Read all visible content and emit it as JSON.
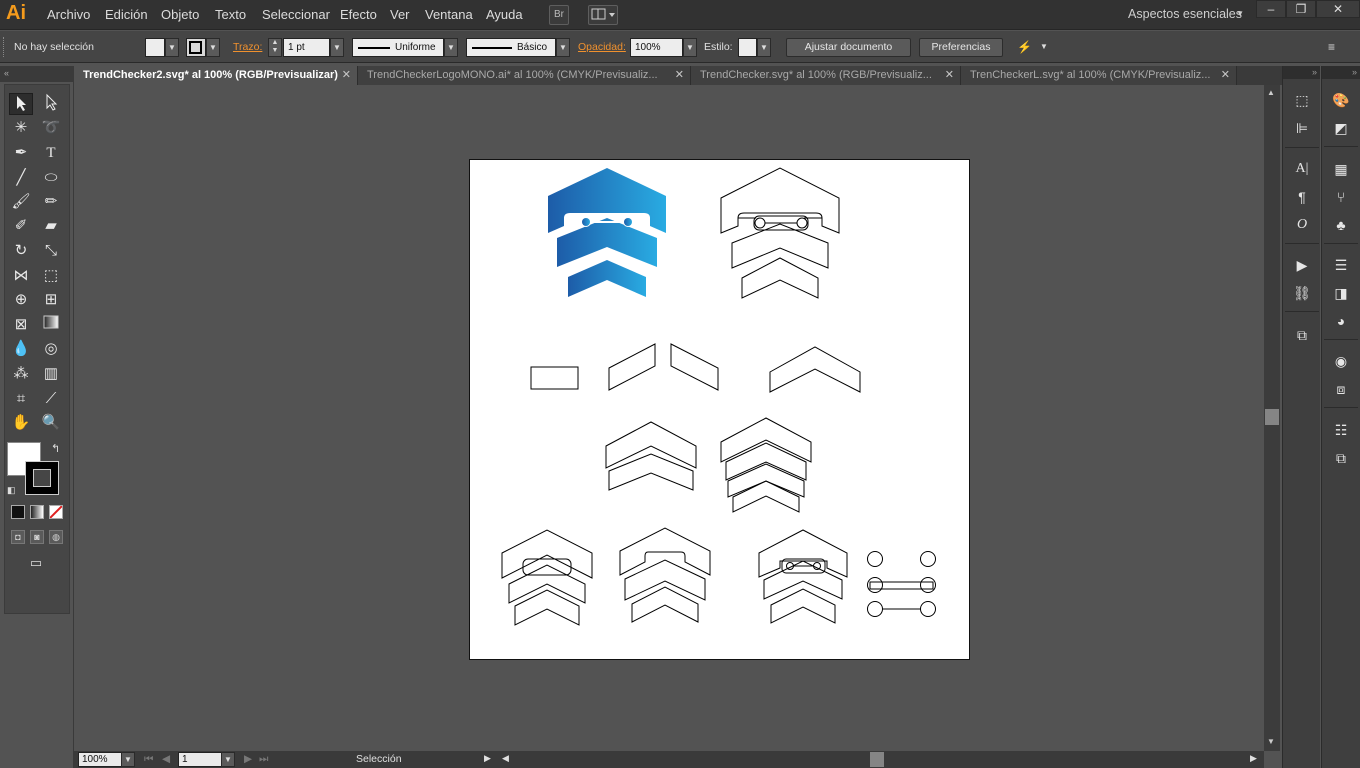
{
  "app": {
    "logo": "Ai"
  },
  "menu": {
    "items": [
      "Archivo",
      "Edición",
      "Objeto",
      "Texto",
      "Seleccionar",
      "Efecto",
      "Ver",
      "Ventana",
      "Ayuda"
    ],
    "bridge": "Br",
    "workspace": "Aspectos esenciales"
  },
  "control": {
    "selection": "No hay selección",
    "stroke_label": "Trazo:",
    "stroke_weight": "1 pt",
    "profile": "Uniforme",
    "brush": "Básico",
    "opacity_label": "Opacidad:",
    "opacity_value": "100%",
    "style_label": "Estilo:",
    "doc_setup": "Ajustar documento",
    "preferences": "Preferencias"
  },
  "tabs": [
    {
      "label": "TrendChecker2.svg* al 100% (RGB/Previsualizar)",
      "active": true
    },
    {
      "label": "TrendCheckerLogoMONO.ai* al 100% (CMYK/Previsualiz...",
      "active": false
    },
    {
      "label": "TrendChecker.svg* al 100% (RGB/Previsualiz...",
      "active": false
    },
    {
      "label": "TrenCheckerL.svg* al 100% (CMYK/Previsualiz...",
      "active": false
    }
  ],
  "status": {
    "zoom": "100%",
    "artboard": "1",
    "tool": "Selección"
  },
  "colors": {
    "logo_blue_dark": "#1d5ca8",
    "logo_blue_light": "#29abe2",
    "accent_orange": "#f59b1c"
  }
}
